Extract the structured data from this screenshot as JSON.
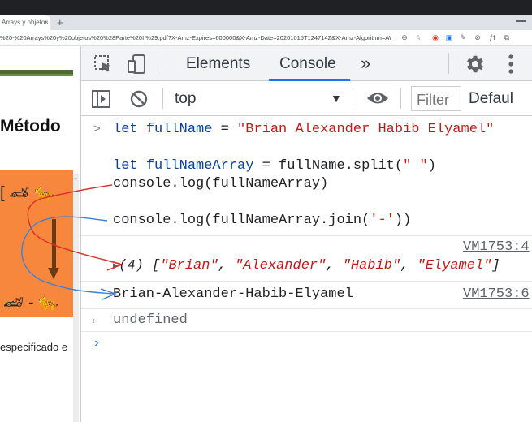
{
  "browser": {
    "tab_title": "Arrays y objetos",
    "tab_close": "×",
    "new_tab": "+",
    "url": "%20-%20Arrays%20y%20objetos%20%28Parte%20II%29.pdf?X-Amz-Expires=600000&X-Amz-Date=20201015T124714Z&X-Amz-Algorithm=AWS...",
    "extensions": [
      "info-icon",
      "star-icon",
      "shield-icon",
      "new-badge-icon",
      "pen-icon",
      "block-icon",
      "ft-icon",
      "puzzle-icon"
    ],
    "extension_glyphs": [
      "⊖",
      "☆",
      "◉",
      "▣",
      "✎",
      "⊘",
      "ƒt",
      "⧉"
    ]
  },
  "page": {
    "heading": "Método",
    "bottom_text": "especificado e",
    "top_row": "[ 🏎 🐆",
    "bottom_row": "🏎 - 🐆"
  },
  "devtools": {
    "tabs": {
      "elements": "Elements",
      "console": "Console",
      "more": "»"
    },
    "filterbar": {
      "context": "top",
      "context_arrow": "▼",
      "filter_placeholder": "Filter",
      "levels": "Defaul"
    }
  },
  "console": {
    "input_prompt": ">",
    "line1": {
      "kw": "let",
      "var": "fullName",
      "op": " = ",
      "str": "\"Brian Alexander Habib Elyamel\""
    },
    "line2": {
      "kw": "let",
      "var": "fullNameArray",
      "op": " = ",
      "rest": "fullName.split(",
      "str": "\" \"",
      "close": ")"
    },
    "line3": "console.log(fullNameArray)",
    "line4": {
      "pre": "console.log(fullNameArray.join(",
      "str": "'-'",
      "post": "))"
    },
    "output1": {
      "source": "VM1753:4",
      "arrow": "▶",
      "count": "(4)",
      "open": " [",
      "items": [
        "\"Brian\"",
        "\"Alexander\"",
        "\"Habib\"",
        "\"Elyamel\""
      ],
      "close": "]"
    },
    "output2": {
      "text": "Brian-Alexander-Habib-Elyamel",
      "source": "VM1753:6"
    },
    "result_prompt": "‹·",
    "result": "undefined",
    "new_prompt": "›"
  },
  "colors": {
    "accent": "#1a73e8",
    "string": "#c41a16",
    "keyword": "#0842a0",
    "annotation_red": "#d9302c",
    "annotation_blue": "#3b82d6"
  }
}
